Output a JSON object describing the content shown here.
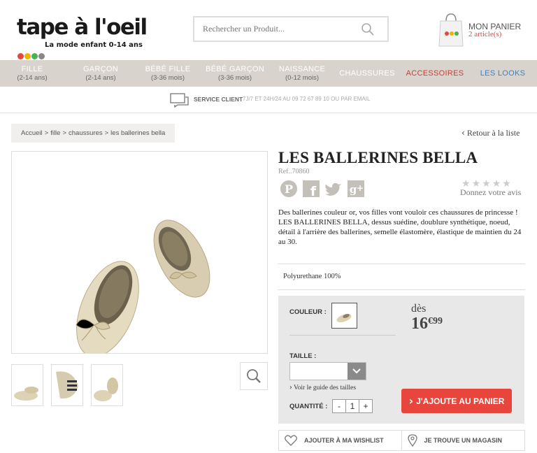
{
  "header": {
    "logo_text": "tape à l'oeil",
    "logo_tagline": "La mode enfant 0-14 ans",
    "search_placeholder": "Rechercher un Produit...",
    "cart_title": "MON PANIER",
    "cart_count": "2 article(s)"
  },
  "nav": [
    {
      "label": "FILLE",
      "sub": "(2-14 ans)"
    },
    {
      "label": "GARÇON",
      "sub": "(2-14 ans)"
    },
    {
      "label": "BÉBÉ FILLE",
      "sub": "(3-36 mois)"
    },
    {
      "label": "BÉBÉ GARÇON",
      "sub": "(3-36 mois)"
    },
    {
      "label": "NAISSANCE",
      "sub": "(0-12 mois)"
    },
    {
      "label": "CHAUSSURES",
      "sub": ""
    },
    {
      "label": "ACCESSOIRES",
      "sub": ""
    },
    {
      "label": "LES LOOKS",
      "sub": ""
    }
  ],
  "service": {
    "title": "SERVICE CLIENT",
    "text": "7J/7 ET 24H/24 AU 09 72 67 89 10 OU PAR EMAIL"
  },
  "breadcrumb": [
    "Accueil",
    "fille",
    "chaussures",
    "les ballerines bella"
  ],
  "back_label": "Retour à la liste",
  "product": {
    "title": "LES BALLERINES BELLA",
    "ref": "Ref..70860",
    "reviews_label": "Donnez votre avis",
    "description_1": "Des ballerines couleur or, vos filles vont vouloir ces chaussures de princesse !",
    "description_2": "LES BALLERINES BELLA, dessus suédine, doublure synthétique, noeud, détail à l'arrière des ballerines, semelle élastomère, élastique de maintien du 24 au 30.",
    "composition": "Polyurethane 100%",
    "rating": 0,
    "rating_max": 5
  },
  "purchase": {
    "color_label": "COULEUR :",
    "from_label": "dès",
    "price_main": "16",
    "price_cents": "€99",
    "size_label": "TAILLE :",
    "size_value": "",
    "guide_label": "Voir le guide des tailles",
    "qty_label": "QUANTITÉ :",
    "qty_minus": "-",
    "qty_value": "1",
    "qty_plus": "+",
    "add_to_cart": "J'AJOUTE AU PANIER"
  },
  "actions": {
    "wishlist": "AJOUTER À MA WISHLIST",
    "store": "JE TROUVE UN MAGASIN"
  },
  "colors": {
    "accent_red": "#e8453c",
    "nav_bg": "#d8d4cd",
    "accessoires": "#d8372e",
    "looks": "#3a82c9",
    "logo_dots": [
      "#e8453c",
      "#f0b400",
      "#4caf50",
      "#888888"
    ]
  }
}
